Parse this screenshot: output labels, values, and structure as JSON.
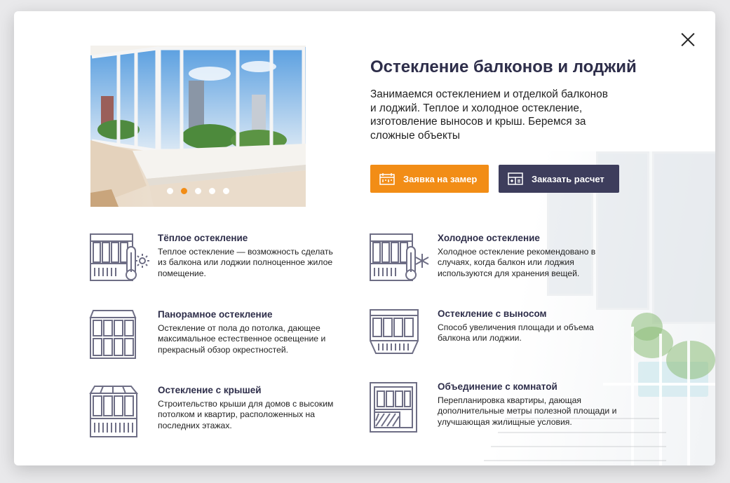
{
  "modal": {
    "title": "Остекление балконов и лоджий",
    "description": "Занимаемся остеклением и отделкой балконов и лоджий. Теплое и холодное остекление, изготовление выносов и крыш. Беремся за сложные объекты",
    "close_icon": "close-icon"
  },
  "slider": {
    "dot_count": 5,
    "active_index": 1
  },
  "buttons": {
    "measure_label": "Заявка на замер",
    "calc_label": "Заказать расчет"
  },
  "features": [
    {
      "title": "Тёплое остекление",
      "text": "Теплое остекление — возможность сделать из балкона или лоджии полноценное жилое помещение.",
      "icon": "warm-glazing-icon"
    },
    {
      "title": "Холодное остекление",
      "text": "Холодное остекление рекомендовано в случаях, когда балкон или лоджия используются для хранения вещей.",
      "icon": "cold-glazing-icon"
    },
    {
      "title": "Панорамное остекление",
      "text": "Остекление от пола до потолка, дающее максимальное естественное освещение и прекрасный обзор окрестностей.",
      "icon": "panoramic-glazing-icon"
    },
    {
      "title": "Остекление с выносом",
      "text": "Способ увеличения площади и объема балкона или лоджии.",
      "icon": "extension-glazing-icon"
    },
    {
      "title": "Остекление с крышей",
      "text": "Строительство крыши для домов с высоким потолком и квартир, расположенных на последних этажах.",
      "icon": "roof-glazing-icon"
    },
    {
      "title": "Объединение с комнатой",
      "text": "Перепланировка квартиры, дающая дополнительные метры полезной площади и улучшающая жилищные условия.",
      "icon": "room-merge-icon"
    }
  ],
  "colors": {
    "accent": "#f28d16",
    "dark_button": "#3d3d5c",
    "heading": "#2e2e4a"
  }
}
